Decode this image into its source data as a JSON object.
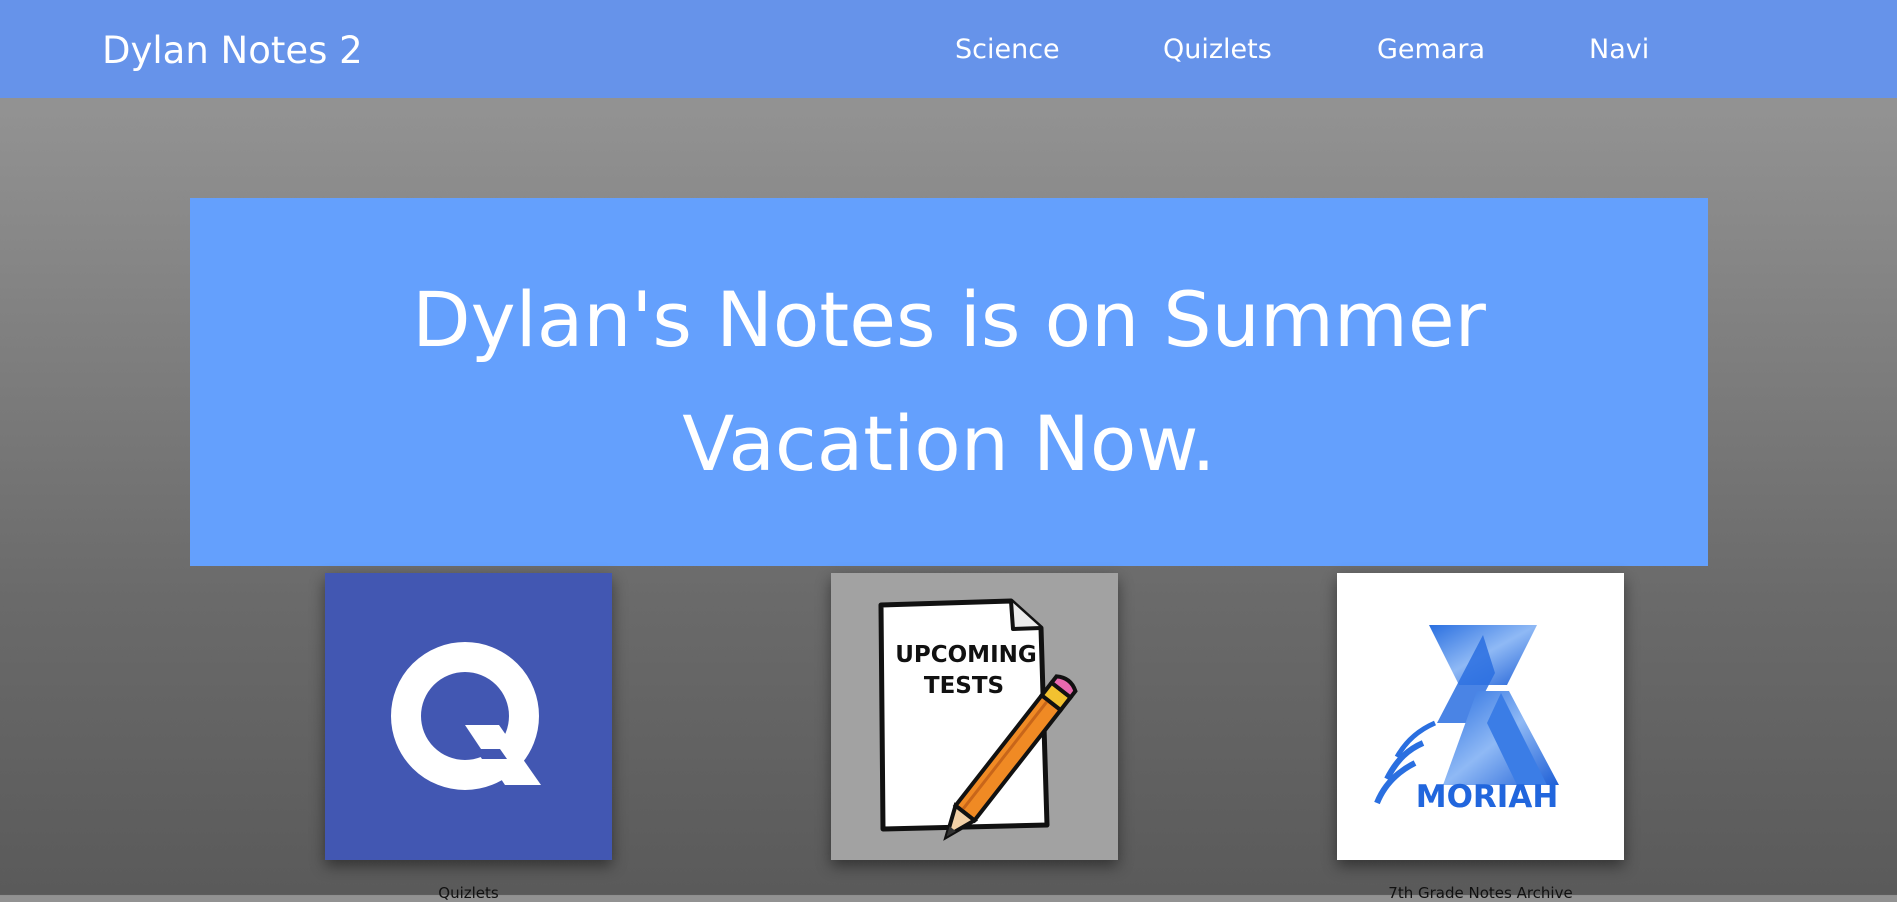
{
  "header": {
    "site_title": "Dylan Notes 2",
    "nav": [
      "Science",
      "Quizlets",
      "Gemara",
      "Navi"
    ]
  },
  "banner": {
    "heading": "Dylan's Notes is on Summer Vacation Now."
  },
  "tiles": [
    {
      "icon": "quizlet-logo-icon",
      "caption": "Quizlets"
    },
    {
      "icon": "upcoming-tests-icon",
      "image_text": [
        "UPCOMING",
        "TESTS"
      ],
      "caption": ""
    },
    {
      "icon": "moriah-logo-icon",
      "image_text": "MORIAH",
      "caption": "7th Grade Notes Archive"
    }
  ],
  "colors": {
    "nav_background": "#6693ea",
    "banner_background": "#64a0fd",
    "quizlet_blue": "#4257b2"
  }
}
